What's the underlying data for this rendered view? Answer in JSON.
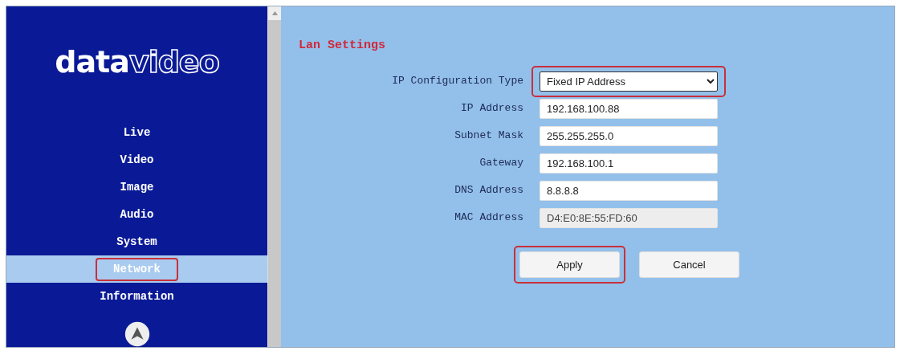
{
  "logo": {
    "bold_part": "data",
    "outline_part": "video"
  },
  "nav": [
    {
      "label": "Live",
      "selected": false,
      "highlighted": false
    },
    {
      "label": "Video",
      "selected": false,
      "highlighted": false
    },
    {
      "label": "Image",
      "selected": false,
      "highlighted": false
    },
    {
      "label": "Audio",
      "selected": false,
      "highlighted": false
    },
    {
      "label": "System",
      "selected": false,
      "highlighted": false
    },
    {
      "label": "Network",
      "selected": true,
      "highlighted": true
    },
    {
      "label": "Information",
      "selected": false,
      "highlighted": false
    }
  ],
  "section_title": "Lan Settings",
  "fields": [
    {
      "kind": "select",
      "label": "IP Configuration Type",
      "value": "Fixed IP Address",
      "disabled": false,
      "highlighted": true
    },
    {
      "kind": "input",
      "label": "IP Address",
      "value": "192.168.100.88",
      "disabled": false,
      "highlighted": false
    },
    {
      "kind": "input",
      "label": "Subnet Mask",
      "value": "255.255.255.0",
      "disabled": false,
      "highlighted": false
    },
    {
      "kind": "input",
      "label": "Gateway",
      "value": "192.168.100.1",
      "disabled": false,
      "highlighted": false
    },
    {
      "kind": "input",
      "label": "DNS Address",
      "value": "8.8.8.8",
      "disabled": false,
      "highlighted": false
    },
    {
      "kind": "input",
      "label": "MAC Address",
      "value": "D4:E0:8E:55:FD:60",
      "disabled": true,
      "highlighted": false
    }
  ],
  "buttons": [
    {
      "label": "Apply",
      "highlighted": true
    },
    {
      "label": "Cancel",
      "highlighted": false
    }
  ]
}
